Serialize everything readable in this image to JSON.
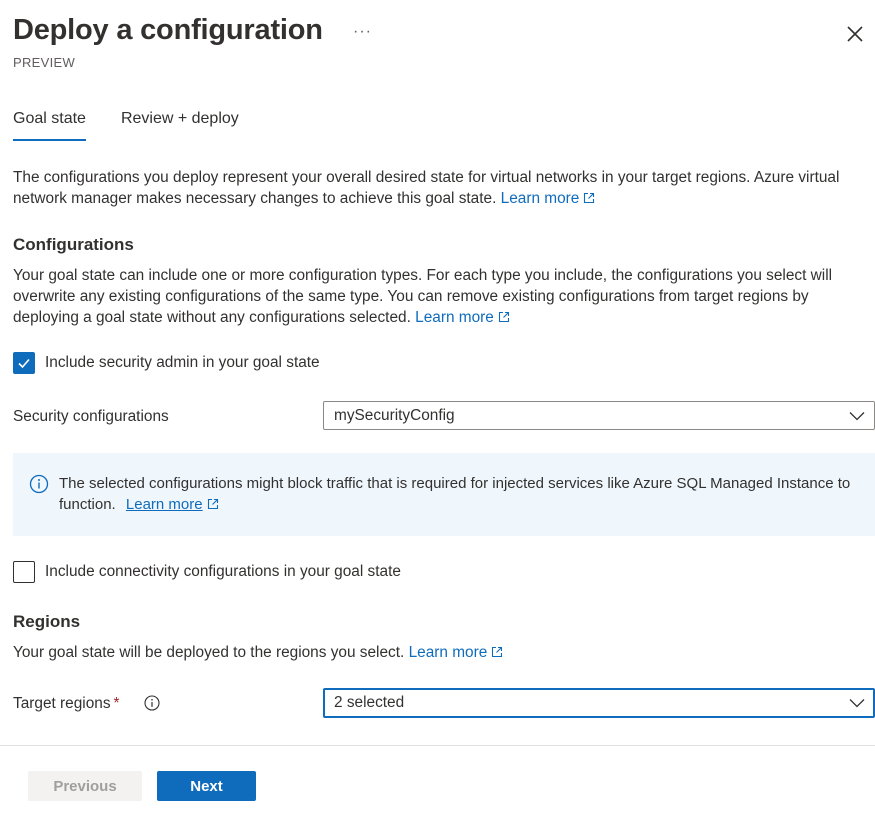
{
  "header": {
    "title": "Deploy a configuration",
    "more_label": "···",
    "subtitle": "PREVIEW"
  },
  "tabs": [
    {
      "label": "Goal state",
      "active": true
    },
    {
      "label": "Review + deploy",
      "active": false
    }
  ],
  "intro": {
    "text": "The configurations you deploy represent your overall desired state for virtual networks in your target regions. Azure virtual network manager makes necessary changes to achieve this goal state.",
    "link": "Learn more"
  },
  "configurations": {
    "heading": "Configurations",
    "text": "Your goal state can include one or more configuration types. For each type you include, the configurations you select will overwrite any existing configurations of the same type. You can remove existing configurations from target regions by deploying a goal state without any configurations selected.",
    "link": "Learn more",
    "security_checkbox": {
      "label": "Include security admin in your goal state",
      "checked": true
    },
    "security_configs": {
      "label": "Security configurations",
      "value": "mySecurityConfig"
    },
    "info": {
      "text": "The selected configurations might block traffic that is required for injected services like Azure SQL Managed Instance to function.",
      "link": "Learn more"
    },
    "connectivity_checkbox": {
      "label": "Include connectivity configurations in your goal state",
      "checked": false
    }
  },
  "regions": {
    "heading": "Regions",
    "text": "Your goal state will be deployed to the regions you select.",
    "link": "Learn more",
    "target": {
      "label": "Target regions",
      "required_mark": "*",
      "value": "2 selected"
    }
  },
  "footer": {
    "previous_label": "Previous",
    "next_label": "Next"
  },
  "colors": {
    "accent": "#0f6cbd",
    "info_bg": "#eff6fc",
    "text": "#323130"
  }
}
